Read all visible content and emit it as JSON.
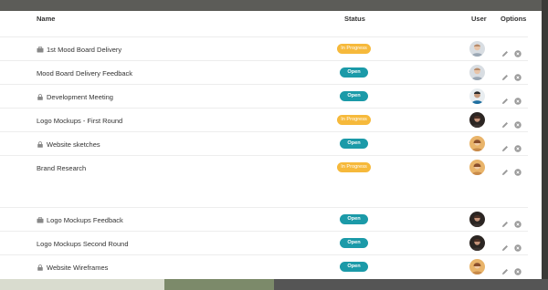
{
  "headers": {
    "name": "Name",
    "status": "Status",
    "user": "User",
    "options": "Options"
  },
  "rows": [
    {
      "name": "1st Mood Board Delivery",
      "icon": "briefcase-icon",
      "status": "In Progress",
      "state": "progress",
      "avatar": "light"
    },
    {
      "name": "Mood Board Delivery Feedback",
      "icon": "",
      "status": "Open",
      "state": "open",
      "avatar": "light"
    },
    {
      "name": "Development Meeting",
      "icon": "lock-icon",
      "status": "Open",
      "state": "open",
      "avatar": "dark-blue"
    },
    {
      "name": "Logo Mockups - First Round",
      "icon": "",
      "status": "In Progress",
      "state": "progress",
      "avatar": "dark"
    },
    {
      "name": "Website sketches",
      "icon": "lock-icon",
      "status": "Open",
      "state": "open",
      "avatar": "warm"
    },
    {
      "name": "Brand Research",
      "icon": "",
      "status": "In Progress",
      "state": "progress",
      "avatar": "warm"
    },
    {
      "name": "Logo Mockups Feedback",
      "icon": "briefcase-icon",
      "status": "Open",
      "state": "open",
      "avatar": "dark"
    },
    {
      "name": "Logo Mockups Second Round",
      "icon": "",
      "status": "Open",
      "state": "open",
      "avatar": "dark"
    },
    {
      "name": "Website Wireframes",
      "icon": "lock-icon",
      "status": "Open",
      "state": "open",
      "avatar": "warm"
    }
  ],
  "colors": {
    "in_progress": "#f6b93b",
    "open": "#1b9aa8"
  }
}
